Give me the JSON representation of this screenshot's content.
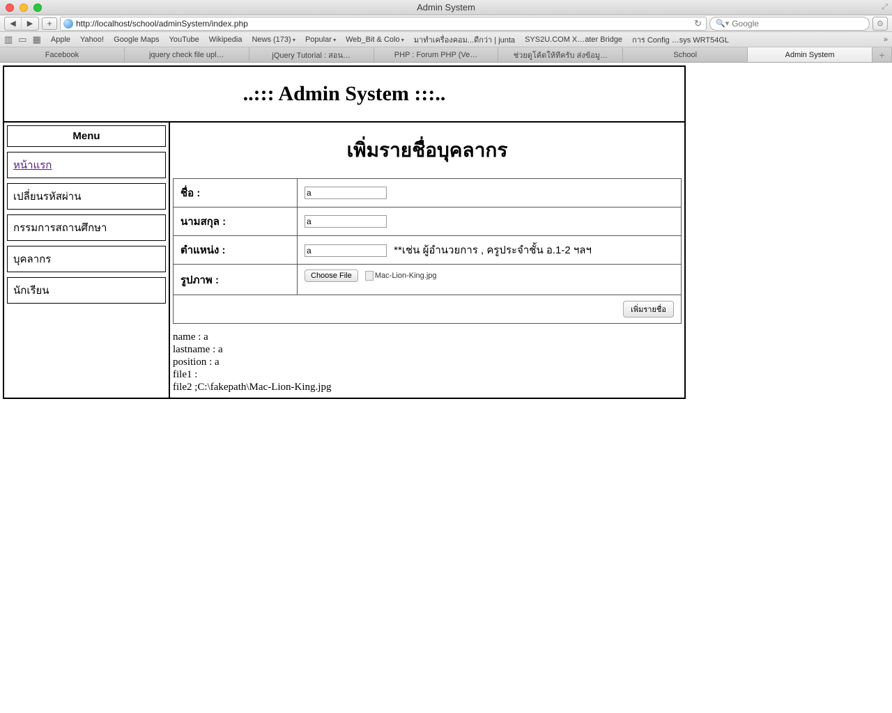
{
  "window": {
    "title": "Admin System"
  },
  "toolbar": {
    "url": "http://localhost/school/adminSystem/index.php",
    "search_placeholder": "Google"
  },
  "bookmarks": {
    "items": [
      {
        "label": "Apple",
        "dd": false
      },
      {
        "label": "Yahoo!",
        "dd": false
      },
      {
        "label": "Google Maps",
        "dd": false
      },
      {
        "label": "YouTube",
        "dd": false
      },
      {
        "label": "Wikipedia",
        "dd": false
      },
      {
        "label": "News (173)",
        "dd": true
      },
      {
        "label": "Popular",
        "dd": true
      },
      {
        "label": "Web_Bit & Colo",
        "dd": true
      },
      {
        "label": "มาทำเครื่องคอม...ดีกว่า | junta",
        "dd": false
      },
      {
        "label": "SYS2U.COM X…ater Bridge",
        "dd": false
      },
      {
        "label": "การ Config …sys WRT54GL",
        "dd": false
      }
    ]
  },
  "tabs": {
    "items": [
      "Facebook",
      "jquery check file upl…",
      "jQuery Tutorial : สอน…",
      "PHP : Forum PHP (Ve…",
      "ช่วยดูโค้ดให้ทีครับ ส่งข้อมู…",
      "School",
      "Admin System"
    ],
    "activeIndex": 6
  },
  "header": {
    "title": "..::: Admin System :::.."
  },
  "sidebar": {
    "menu_label": "Menu",
    "items": [
      {
        "label": "หน้าแรก",
        "link": true
      },
      {
        "label": "เปลี่ยนรหัสผ่าน",
        "link": false
      },
      {
        "label": "กรรมการสถานศึกษา",
        "link": false
      },
      {
        "label": "บุคลากร",
        "link": false
      },
      {
        "label": "นักเรียน",
        "link": false
      }
    ]
  },
  "form": {
    "heading": "เพิ่มรายชื่อบุคลากร",
    "rows": {
      "name_label": "ชื่อ :",
      "name_value": "a",
      "lastname_label": "นามสกุล :",
      "lastname_value": "a",
      "position_label": "ตำแหน่ง :",
      "position_value": "a",
      "position_hint": "**เช่น ผู้อำนวยการ , ครูประจำชั้น อ.1-2 ฯลฯ",
      "photo_label": "รูปภาพ :",
      "choose_file": "Choose File",
      "file_selected": "Mac-Lion-King.jpg"
    },
    "submit_label": "เพิ่มรายชื่อ"
  },
  "debug": {
    "l1": "name : a",
    "l2": "lastname : a",
    "l3": "position : a",
    "l4": "file1 :",
    "l5": "file2 ;C:\\fakepath\\Mac-Lion-King.jpg"
  }
}
